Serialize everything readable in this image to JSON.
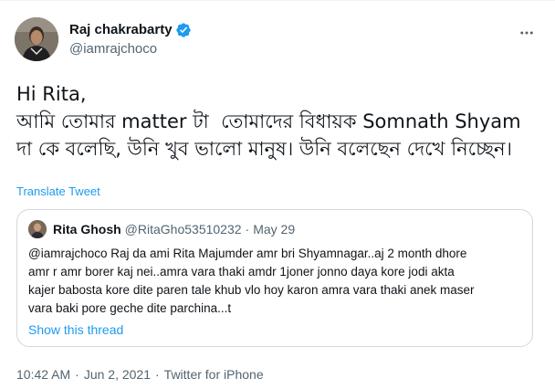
{
  "author": {
    "display_name": "Raj chakrabarty",
    "handle": "@iamrajchoco",
    "verified": true
  },
  "tweet": {
    "text": "Hi Rita,\nআমি তোমার matter টা  তোমাদের বিধায়ক Somnath Shyam দা কে বলেছি, উনি খুব ভালো মানুষ। উনি বলেছেন দেখে নিচ্ছেন।",
    "translate_label": "Translate Tweet"
  },
  "quoted": {
    "display_name": "Rita Ghosh",
    "handle": "@RitaGho53510232",
    "separator": "·",
    "date": "May 29",
    "lines": [
      "@iamrajchoco Raj da ami Rita Majumder amr bri Shyamnagar..aj 2 month dhore",
      "amr r amr borer kaj nei..amra vara thaki amdr 1joner jonno daya kore jodi akta",
      "kajer babosta kore dite paren tale khub vlo hoy karon amra vara thaki anek maser",
      "vara baki pore geche dite parchina...t"
    ],
    "show_thread_label": "Show this thread"
  },
  "meta": {
    "time": "10:42 AM",
    "separator": "·",
    "date": "Jun 2, 2021",
    "source": "Twitter for iPhone"
  },
  "colors": {
    "accent": "#1d9bf0",
    "secondary_text": "#536471",
    "border": "#cfd9de"
  },
  "icons": {
    "verified": "verified-badge-icon",
    "more": "more-options-icon"
  }
}
